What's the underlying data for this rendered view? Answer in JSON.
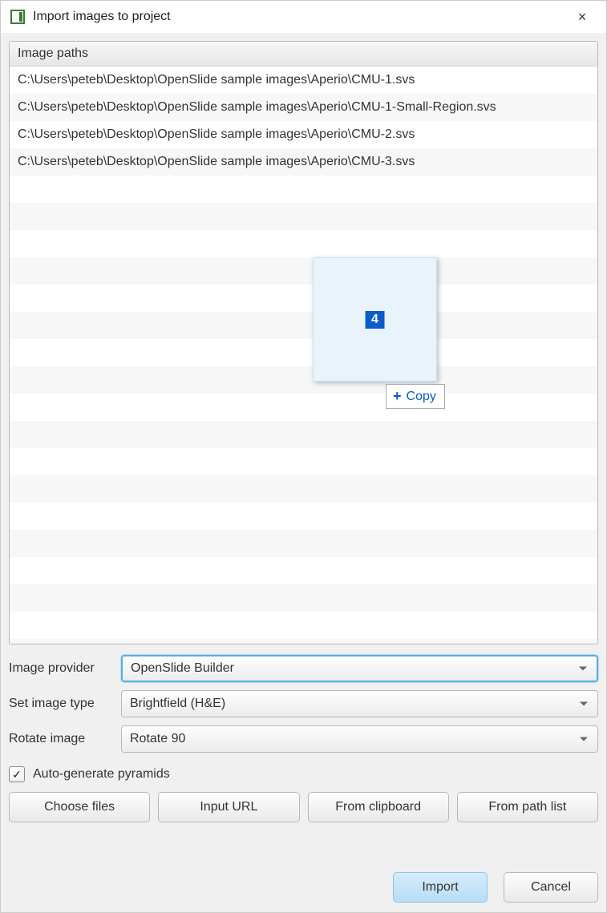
{
  "window": {
    "title": "Import images to project",
    "close_icon": "×"
  },
  "paths_panel": {
    "header": "Image paths",
    "items": [
      "C:\\Users\\peteb\\Desktop\\OpenSlide sample images\\Aperio\\CMU-1.svs",
      "C:\\Users\\peteb\\Desktop\\OpenSlide sample images\\Aperio\\CMU-1-Small-Region.svs",
      "C:\\Users\\peteb\\Desktop\\OpenSlide sample images\\Aperio\\CMU-2.svs",
      "C:\\Users\\peteb\\Desktop\\OpenSlide sample images\\Aperio\\CMU-3.svs"
    ]
  },
  "drag": {
    "count": "4",
    "action": "Copy",
    "plus": "+"
  },
  "form": {
    "provider_label": "Image provider",
    "provider_value": "OpenSlide Builder",
    "type_label": "Set image type",
    "type_value": "Brightfield (H&E)",
    "rotate_label": "Rotate image",
    "rotate_value": "Rotate 90"
  },
  "checkbox": {
    "label": "Auto-generate pyramids",
    "checked": "✓"
  },
  "buttons": {
    "choose_files": "Choose files",
    "input_url": "Input URL",
    "from_clipboard": "From clipboard",
    "from_path_list": "From path list",
    "import": "Import",
    "cancel": "Cancel"
  }
}
